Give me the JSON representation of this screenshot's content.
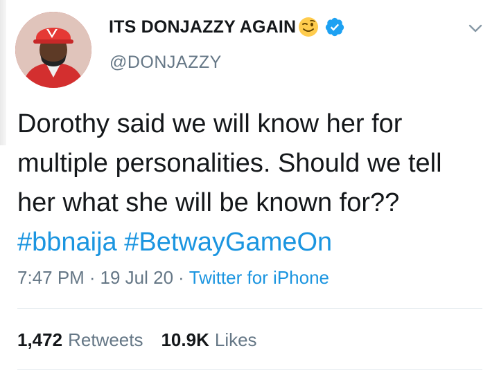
{
  "author": {
    "display_name": "ITS DONJAZZY AGAIN",
    "handle": "@DONJAZZY",
    "emoji_icon": "winking-face-icon",
    "verified_icon": "verified-badge-icon"
  },
  "tweet": {
    "text_plain": "Dorothy said we will know her for multiple personalities. Should we tell her what she will be known for??",
    "hashtags": [
      "#bbnaija",
      "#BetwayGameOn"
    ]
  },
  "meta": {
    "time": "7:47 PM",
    "date": "19 Jul 20",
    "source": "Twitter for iPhone",
    "separator": "·"
  },
  "stats": {
    "retweets_count": "1,472",
    "retweets_label": "Retweets",
    "likes_count": "10.9K",
    "likes_label": "Likes"
  },
  "colors": {
    "link": "#1b95e0",
    "secondary_text": "#657786",
    "verified": "#1da1f2",
    "avatar_bg": "#b71c1c"
  }
}
